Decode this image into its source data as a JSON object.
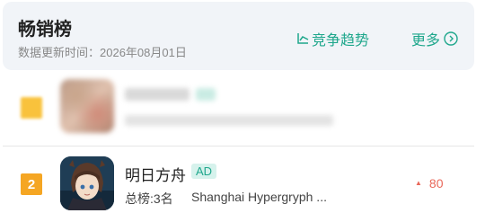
{
  "header": {
    "title": "畅销榜",
    "update_label": "数据更新时间：2026年08月01日",
    "trend_label": "竞争趋势",
    "more_label": "更多"
  },
  "rows": [
    {
      "rank": "",
      "obscured": true
    },
    {
      "rank": "2",
      "name": "明日方舟",
      "tag": "AD",
      "rank_info": "总榜:3名",
      "developer": "Shanghai Hypergryph ...",
      "change": "80",
      "change_direction": "up"
    }
  ],
  "colors": {
    "accent": "#1fa78c",
    "rank_badge": "#f5a623",
    "change_up": "#e9685a"
  }
}
